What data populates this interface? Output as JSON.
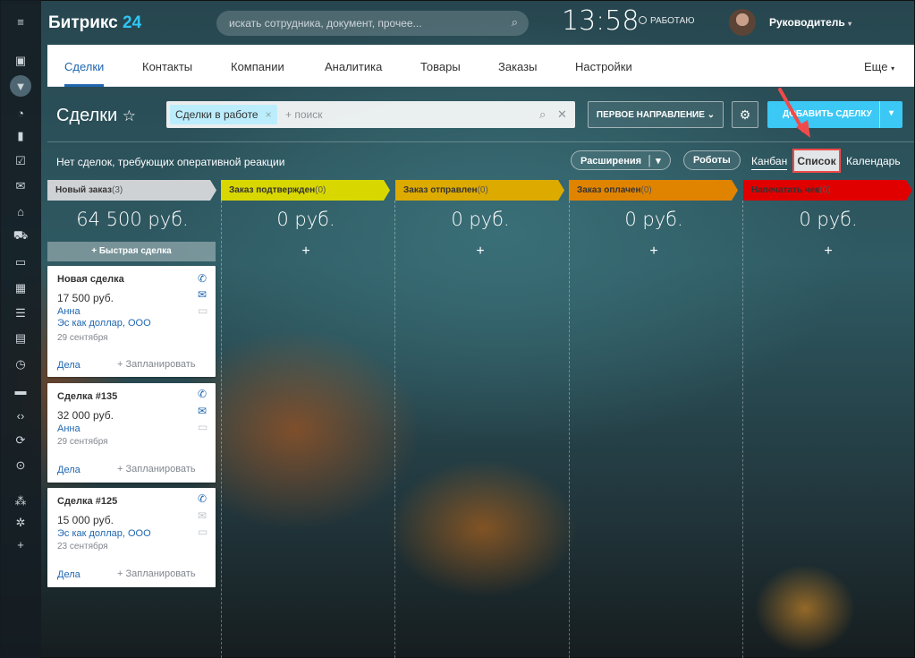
{
  "header": {
    "logo_main": "Битрикс",
    "logo_num": "24",
    "search_placeholder": "искать сотрудника, документ, прочее...",
    "time": "13:58",
    "status": "РАБОТАЮ",
    "user": "Руководитель"
  },
  "rail_icons": [
    "menu-icon",
    "android-icon",
    "filter-icon",
    "chart-pie-icon",
    "bar-chart-icon",
    "checklist-icon",
    "mail-icon",
    "crm-icon",
    "cart-icon",
    "calendar-icon",
    "grid-icon",
    "sliders-icon",
    "planner-icon",
    "clock-icon",
    "drive-icon",
    "code-icon",
    "sync-icon",
    "down-circle-icon",
    "sitemap-icon",
    "gear-icon",
    "plus-icon"
  ],
  "nav": {
    "tabs": [
      "Сделки",
      "Контакты",
      "Компании",
      "Аналитика",
      "Товары",
      "Заказы",
      "Настройки"
    ],
    "more": "Еще"
  },
  "toolbar": {
    "title": "Сделки",
    "filter_chip": "Сделки в работе",
    "search_placeholder": "+ поиск",
    "direction": "ПЕРВОЕ НАПРАВЛЕНИЕ",
    "add": "ДОБАВИТЬ СДЕЛКУ"
  },
  "subbar": {
    "message": "Нет сделок, требующих оперативной реакции",
    "extensions": "Расширения",
    "robots": "Роботы",
    "views": [
      "Канбан",
      "Список",
      "Календарь"
    ]
  },
  "stages": [
    {
      "name": "Новый заказ",
      "count": "(3)",
      "color": "#cfd2d5",
      "sum": "64 500 руб."
    },
    {
      "name": "Заказ подтвержден",
      "count": "(0)",
      "color": "#d8d700",
      "sum": "0 руб."
    },
    {
      "name": "Заказ отправлен",
      "count": "(0)",
      "color": "#ddaa00",
      "sum": "0 руб."
    },
    {
      "name": "Заказ оплачен",
      "count": "(0)",
      "color": "#e08400",
      "sum": "0 руб."
    },
    {
      "name": "Напечатать чек",
      "count": "(0)",
      "color": "#e00000",
      "sum": "0 руб."
    }
  ],
  "quick_deal": "+ Быстрая сделка",
  "cards": [
    {
      "title": "Новая сделка",
      "price": "17 500 руб.",
      "contact": "Анна",
      "company": "Эс как доллар, ООО",
      "date": "29 сентября",
      "deals": "Дела",
      "plan": "+ Запланировать"
    },
    {
      "title": "Сделка #135",
      "price": "32 000 руб.",
      "contact": "Анна",
      "company": "",
      "date": "29 сентября",
      "deals": "Дела",
      "plan": "+ Запланировать"
    },
    {
      "title": "Сделка #125",
      "price": "15 000 руб.",
      "contact": "",
      "company": "Эс как доллар, ООО",
      "date": "23 сентября",
      "deals": "Дела",
      "plan": "+ Запланировать"
    }
  ],
  "colors": {
    "accent": "#3bc8f5",
    "link": "#2067b0",
    "highlight": "#f04a4a"
  }
}
